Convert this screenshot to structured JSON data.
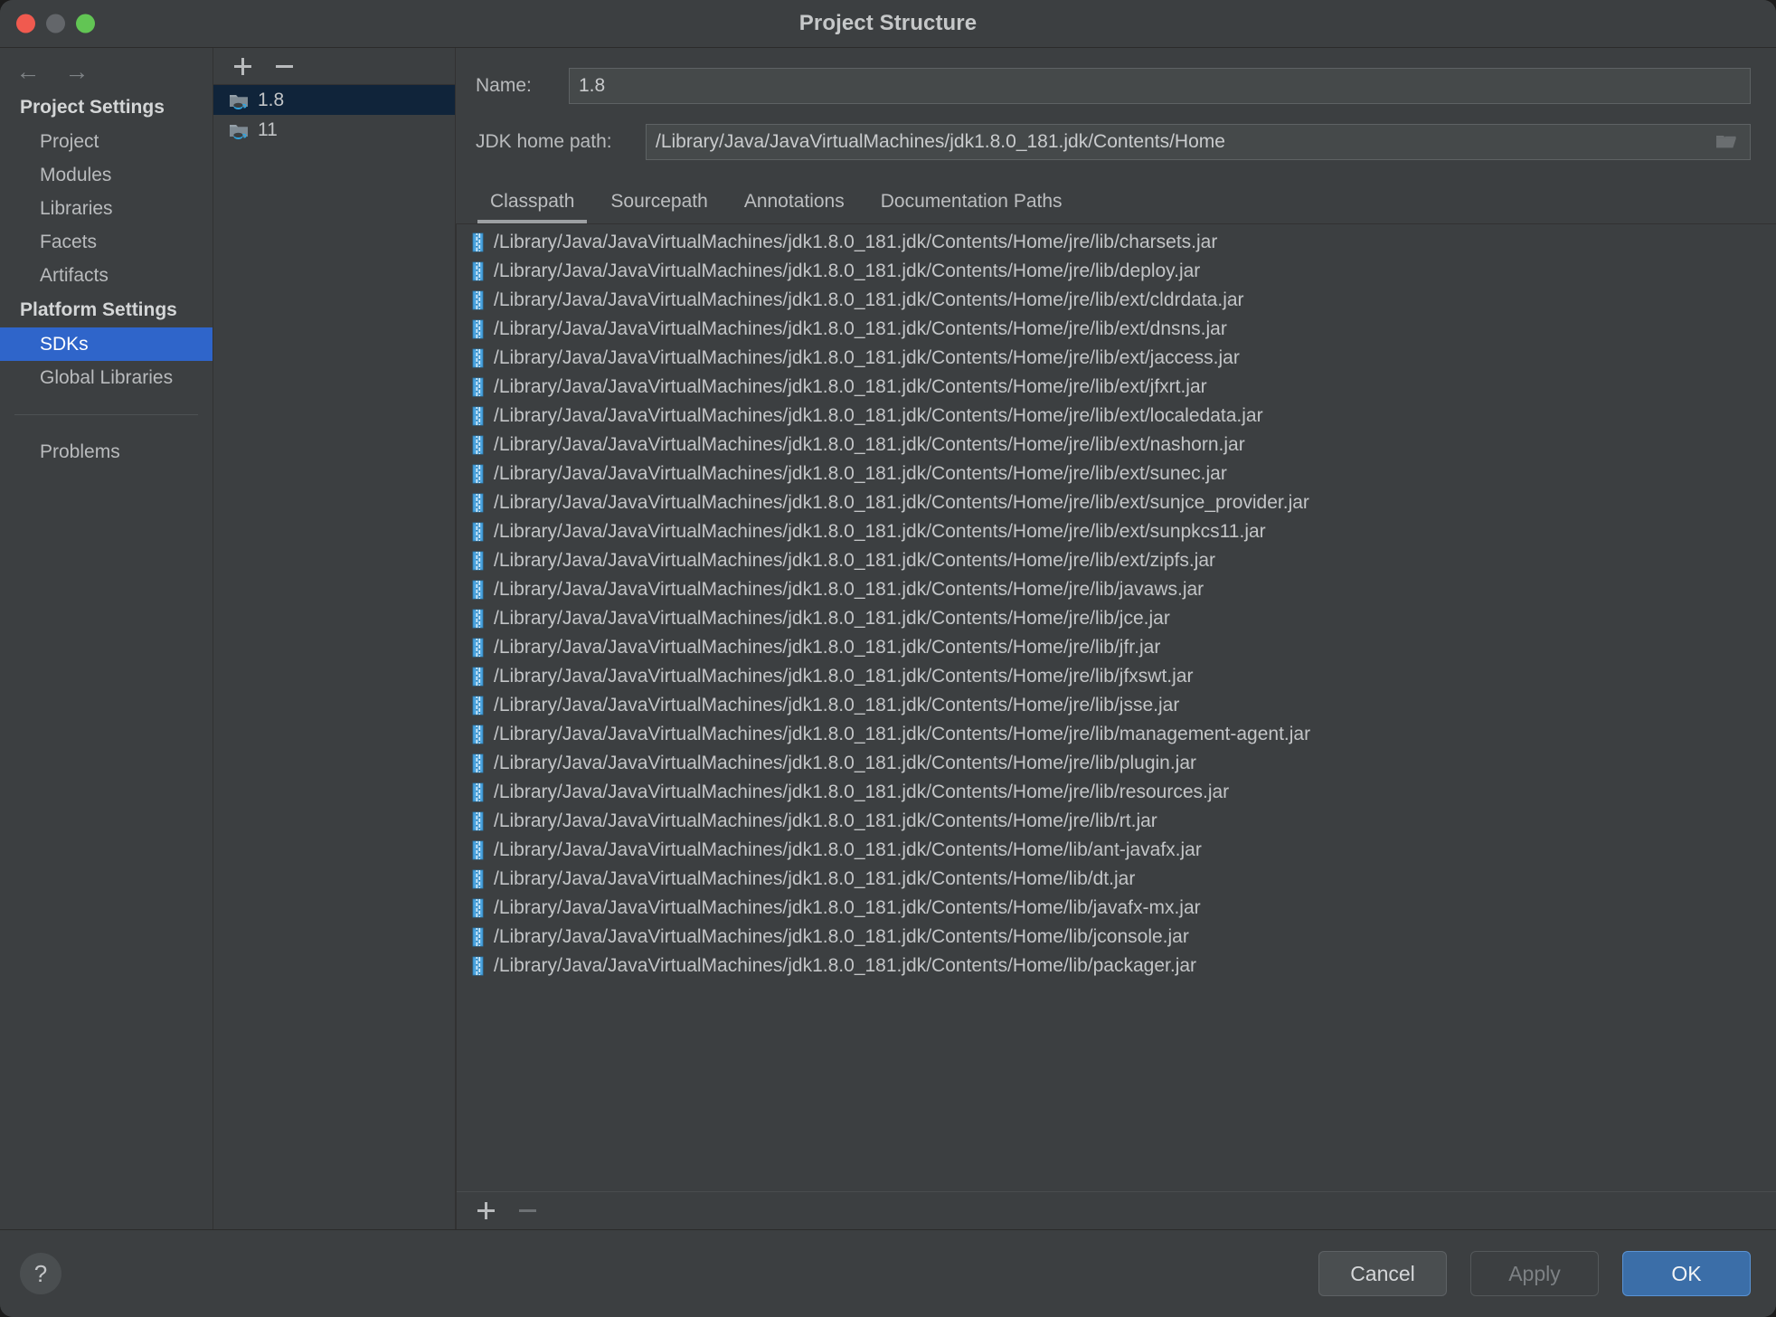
{
  "window": {
    "title": "Project Structure",
    "traffic_lights": [
      "close",
      "minimize",
      "zoom"
    ]
  },
  "nav": {
    "back_icon": "←",
    "forward_icon": "→"
  },
  "sidebar": {
    "groups": [
      {
        "title": "Project Settings",
        "items": [
          {
            "label": "Project",
            "selected": false
          },
          {
            "label": "Modules",
            "selected": false
          },
          {
            "label": "Libraries",
            "selected": false
          },
          {
            "label": "Facets",
            "selected": false
          },
          {
            "label": "Artifacts",
            "selected": false
          }
        ]
      },
      {
        "title": "Platform Settings",
        "items": [
          {
            "label": "SDKs",
            "selected": true
          },
          {
            "label": "Global Libraries",
            "selected": false
          }
        ]
      }
    ],
    "extra_items": [
      {
        "label": "Problems",
        "selected": false
      }
    ]
  },
  "sdk_panel": {
    "toolbar": {
      "add_label": "+",
      "remove_label": "−"
    },
    "items": [
      {
        "name": "1.8",
        "icon": "jdk-icon",
        "selected": true
      },
      {
        "name": "11",
        "icon": "jdk-icon",
        "selected": false
      }
    ]
  },
  "details": {
    "name_label": "Name:",
    "name_value": "1.8",
    "name_placeholder": "",
    "path_label": "JDK home path:",
    "path_value": "/Library/Java/JavaVirtualMachines/jdk1.8.0_181.jdk/Contents/Home",
    "path_placeholder": "",
    "browse_icon": "folder-icon"
  },
  "tabs": [
    {
      "label": "Classpath",
      "active": true
    },
    {
      "label": "Sourcepath",
      "active": false
    },
    {
      "label": "Annotations",
      "active": false
    },
    {
      "label": "Documentation Paths",
      "active": false
    }
  ],
  "classpath": {
    "entries": [
      "/Library/Java/JavaVirtualMachines/jdk1.8.0_181.jdk/Contents/Home/jre/lib/charsets.jar",
      "/Library/Java/JavaVirtualMachines/jdk1.8.0_181.jdk/Contents/Home/jre/lib/deploy.jar",
      "/Library/Java/JavaVirtualMachines/jdk1.8.0_181.jdk/Contents/Home/jre/lib/ext/cldrdata.jar",
      "/Library/Java/JavaVirtualMachines/jdk1.8.0_181.jdk/Contents/Home/jre/lib/ext/dnsns.jar",
      "/Library/Java/JavaVirtualMachines/jdk1.8.0_181.jdk/Contents/Home/jre/lib/ext/jaccess.jar",
      "/Library/Java/JavaVirtualMachines/jdk1.8.0_181.jdk/Contents/Home/jre/lib/ext/jfxrt.jar",
      "/Library/Java/JavaVirtualMachines/jdk1.8.0_181.jdk/Contents/Home/jre/lib/ext/localedata.jar",
      "/Library/Java/JavaVirtualMachines/jdk1.8.0_181.jdk/Contents/Home/jre/lib/ext/nashorn.jar",
      "/Library/Java/JavaVirtualMachines/jdk1.8.0_181.jdk/Contents/Home/jre/lib/ext/sunec.jar",
      "/Library/Java/JavaVirtualMachines/jdk1.8.0_181.jdk/Contents/Home/jre/lib/ext/sunjce_provider.jar",
      "/Library/Java/JavaVirtualMachines/jdk1.8.0_181.jdk/Contents/Home/jre/lib/ext/sunpkcs11.jar",
      "/Library/Java/JavaVirtualMachines/jdk1.8.0_181.jdk/Contents/Home/jre/lib/ext/zipfs.jar",
      "/Library/Java/JavaVirtualMachines/jdk1.8.0_181.jdk/Contents/Home/jre/lib/javaws.jar",
      "/Library/Java/JavaVirtualMachines/jdk1.8.0_181.jdk/Contents/Home/jre/lib/jce.jar",
      "/Library/Java/JavaVirtualMachines/jdk1.8.0_181.jdk/Contents/Home/jre/lib/jfr.jar",
      "/Library/Java/JavaVirtualMachines/jdk1.8.0_181.jdk/Contents/Home/jre/lib/jfxswt.jar",
      "/Library/Java/JavaVirtualMachines/jdk1.8.0_181.jdk/Contents/Home/jre/lib/jsse.jar",
      "/Library/Java/JavaVirtualMachines/jdk1.8.0_181.jdk/Contents/Home/jre/lib/management-agent.jar",
      "/Library/Java/JavaVirtualMachines/jdk1.8.0_181.jdk/Contents/Home/jre/lib/plugin.jar",
      "/Library/Java/JavaVirtualMachines/jdk1.8.0_181.jdk/Contents/Home/jre/lib/resources.jar",
      "/Library/Java/JavaVirtualMachines/jdk1.8.0_181.jdk/Contents/Home/jre/lib/rt.jar",
      "/Library/Java/JavaVirtualMachines/jdk1.8.0_181.jdk/Contents/Home/lib/ant-javafx.jar",
      "/Library/Java/JavaVirtualMachines/jdk1.8.0_181.jdk/Contents/Home/lib/dt.jar",
      "/Library/Java/JavaVirtualMachines/jdk1.8.0_181.jdk/Contents/Home/lib/javafx-mx.jar",
      "/Library/Java/JavaVirtualMachines/jdk1.8.0_181.jdk/Contents/Home/lib/jconsole.jar",
      "/Library/Java/JavaVirtualMachines/jdk1.8.0_181.jdk/Contents/Home/lib/packager.jar"
    ],
    "toolbar": {
      "add_label": "+",
      "remove_label": "−"
    }
  },
  "footer": {
    "help_label": "?",
    "cancel_label": "Cancel",
    "apply_label": "Apply",
    "ok_label": "OK"
  },
  "colors": {
    "window_bg": "#3c3f41",
    "selection_blue": "#2f65ca",
    "list_selection": "#10243a",
    "primary_button": "#3b6ea8",
    "jar_icon": "#4aa3df",
    "java_cup": "#3ba9e0"
  }
}
